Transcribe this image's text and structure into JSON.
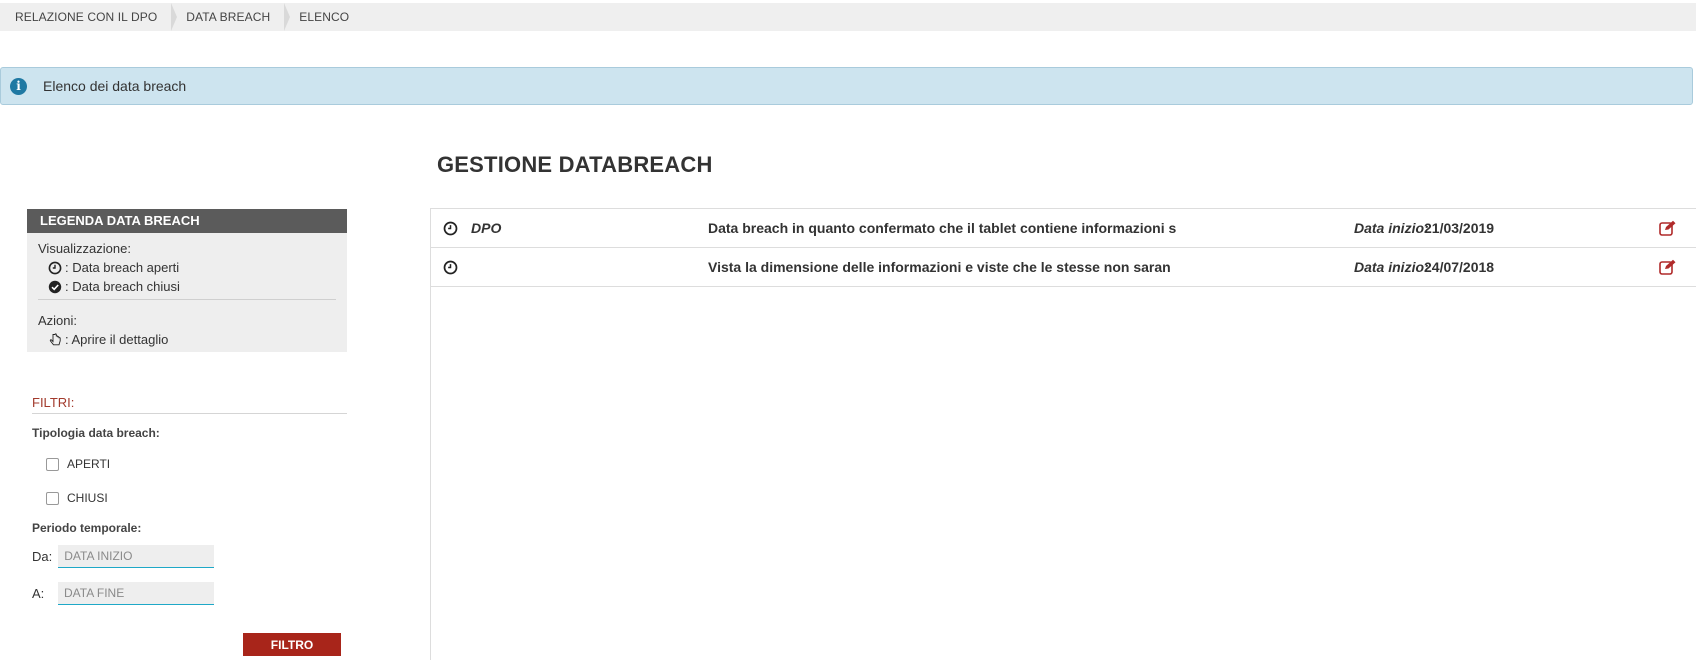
{
  "breadcrumb": [
    {
      "label": "RELAZIONE CON IL DPO"
    },
    {
      "label": "DATA BREACH"
    },
    {
      "label": "ELENCO"
    }
  ],
  "info": {
    "text": "Elenco dei data breach",
    "icon": "info-icon"
  },
  "page_title": "GESTIONE DATABREACH",
  "legend": {
    "title": "LEGENDA DATA BREACH",
    "visualization_label": "Visualizzazione:",
    "open_label": ": Data breach aperti",
    "closed_label": ": Data breach chiusi",
    "actions_label": "Azioni:",
    "detail_label": ": Aprire il dettaglio"
  },
  "filters": {
    "title": "FILTRI:",
    "type_label": "Tipologia data breach:",
    "open_option": "APERTI",
    "closed_option": "CHIUSI",
    "period_label": "Periodo temporale:",
    "from_label": "Da:",
    "from_placeholder": "DATA INIZIO",
    "to_label": "A:",
    "to_placeholder": "DATA FINE",
    "button_label": "FILTRO"
  },
  "rows": [
    {
      "author": "DPO",
      "description": "Data breach in quanto confermato che il tablet contiene informazioni s",
      "date_label": "Data inizio:",
      "date": "21/03/2019"
    },
    {
      "author": "",
      "description": "Vista la dimensione delle informazioni e viste che le stesse non saran",
      "date_label": "Data inizio:",
      "date": "24/07/2018"
    }
  ],
  "colors": {
    "accent_red": "#a8251a",
    "info_bg": "#cde4ef",
    "legend_head": "#5b5b5b",
    "edit_icon": "#b02a2a"
  }
}
